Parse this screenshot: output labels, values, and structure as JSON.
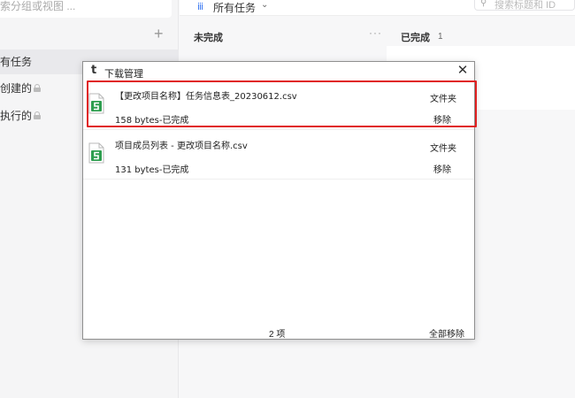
{
  "sidebar": {
    "search_placeholder": "索分组或视图 ...",
    "add_symbol": "+",
    "items": [
      {
        "label": "有任务",
        "locked": false
      },
      {
        "label": "创建的",
        "locked": true
      },
      {
        "label": "执行的",
        "locked": true
      }
    ]
  },
  "header": {
    "view_icon": "ⅲ",
    "view_label": "所有任务",
    "chevron": "⌄",
    "search_placeholder": "搜索标题和 ID"
  },
  "board": {
    "columns": [
      {
        "title": "未完成",
        "more": "···"
      },
      {
        "title": "已完成",
        "count": "1"
      }
    ]
  },
  "dialog": {
    "app_icon": "t",
    "title": "下载管理",
    "close_symbol": "✕",
    "items": [
      {
        "file_name": "【更改项目名称】任务信息表_20230612.csv",
        "status": "158 bytes-已完成",
        "folder_label": "文件夹",
        "remove_label": "移除"
      },
      {
        "file_name": "项目成员列表 - 更改项目名称.csv",
        "status": "131 bytes-已完成",
        "folder_label": "文件夹",
        "remove_label": "移除"
      }
    ],
    "footer_count": "2 项",
    "remove_all_label": "全部移除"
  },
  "colors": {
    "accent": "#3a78f2",
    "highlight": "#e02020",
    "file_icon_green": "#2e9e4f"
  }
}
